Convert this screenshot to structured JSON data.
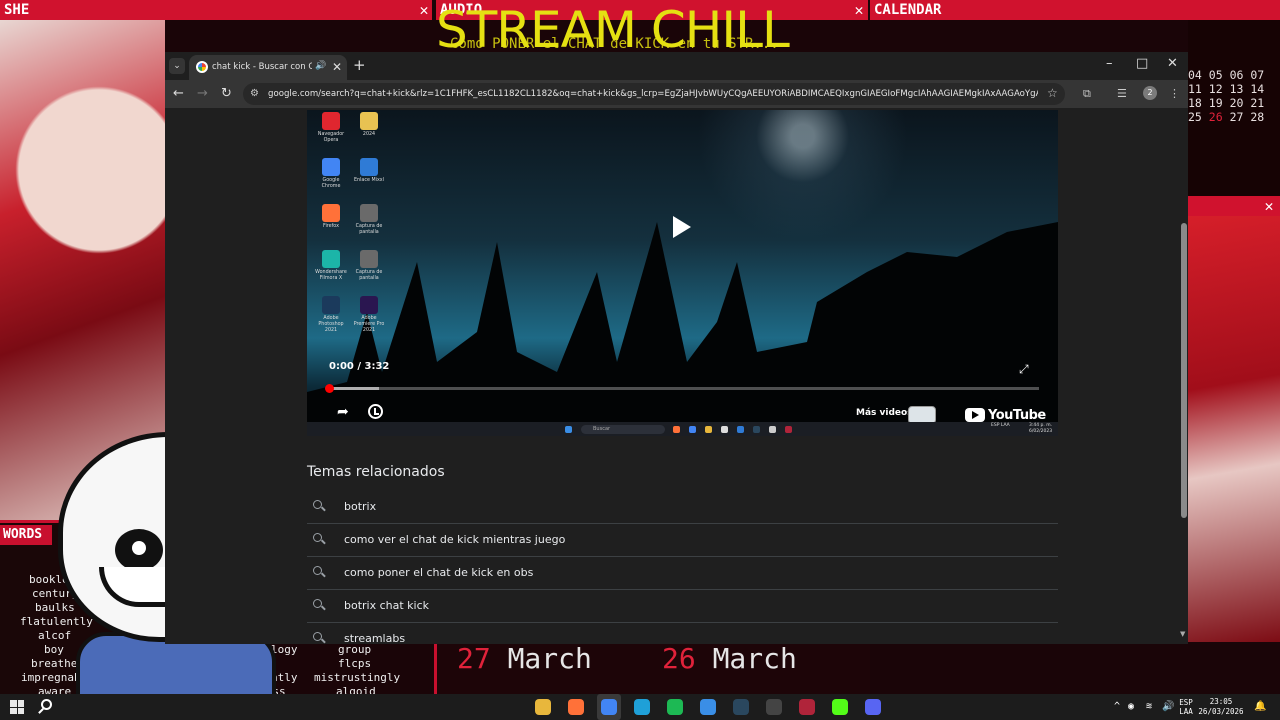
{
  "overlay": {
    "panels": {
      "she": "SHE",
      "audio": "AUDIO",
      "calendar": "CALENDAR",
      "words": "WORDS"
    },
    "stream_title": "STREAM CHILL",
    "audio_track": "Como PONER el CHAT de KICK en tu STR...",
    "calendar_rows": [
      [
        "04",
        "05",
        "06",
        "07"
      ],
      [
        "11",
        "12",
        "13",
        "14"
      ],
      [
        "18",
        "19",
        "20",
        "21"
      ],
      [
        "25",
        "26",
        "27",
        "28"
      ]
    ],
    "calendar_today": "26",
    "words": [
      "booklet",
      "century",
      "baulks",
      "flatulently",
      "alcof",
      "boy",
      "breathe",
      "impregnably",
      "aware",
      "anthropology",
      "brays",
      "inconstantly",
      "childless",
      "group",
      "flcps",
      "mistrustingly",
      "algoid"
    ],
    "dates": [
      {
        "num": "27",
        "month": "March"
      },
      {
        "num": "26",
        "month": "March"
      }
    ]
  },
  "browser": {
    "tab": {
      "title": "chat kick - Buscar con Google",
      "audio_icon": "speaker-icon"
    },
    "url": "google.com/search?q=chat+kick&rlz=1C1FHFK_esCL1182CL1182&oq=chat+kick&gs_lcrp=EgZjaHJvbWUyCQgAEEUYORiABDIMCAEQIxgnGIAEGIoFMgcIAhAAGIAEMgkIAxAAGAoYgAQyB",
    "profile_badge": "2"
  },
  "video": {
    "time": "0:00 / 3:32",
    "progress": 0.0,
    "more_videos": "Más videos",
    "youtube": "YouTube",
    "desktop_icons": [
      {
        "label": "Navegador Opera",
        "color": "#e0262f"
      },
      {
        "label": "2024",
        "color": "#e8c252"
      },
      {
        "label": "Google Chrome",
        "color": "#4285f4"
      },
      {
        "label": "Enlace Mixxl",
        "color": "#2f7bd6"
      },
      {
        "label": "Firefox",
        "color": "#ff7139"
      },
      {
        "label": "Captura de pantalla",
        "color": "#6a6a6a"
      },
      {
        "label": "Wondershare Filmora X",
        "color": "#1cb5a8"
      },
      {
        "label": "Captura de pantalla",
        "color": "#6a6a6a"
      },
      {
        "label": "Adobe Photoshop 2021",
        "color": "#1b3a5c"
      },
      {
        "label": "Adobe Premiere Pro 2021",
        "color": "#2a1650"
      }
    ],
    "inner_taskbar": {
      "search": "Buscar",
      "lang": "ESP LAA",
      "clock": "3:44 p. m. 6/02/2023"
    }
  },
  "related": {
    "title": "Temas relacionados",
    "items": [
      "botrix",
      "como ver el chat de kick mientras juego",
      "como poner el chat de kick en obs",
      "botrix chat kick",
      "streamlabs"
    ]
  },
  "taskbar": {
    "apps": [
      {
        "name": "file-explorer-icon",
        "color": "#e8b73c"
      },
      {
        "name": "firefox-icon",
        "color": "#ff7139"
      },
      {
        "name": "chrome-icon",
        "color": "#4285f4"
      },
      {
        "name": "edge-icon",
        "color": "#1fa0d8"
      },
      {
        "name": "spotify-icon",
        "color": "#1db954"
      },
      {
        "name": "app-icon",
        "color": "#3a8ee6"
      },
      {
        "name": "steam-icon",
        "color": "#2a475e"
      },
      {
        "name": "obs-icon",
        "color": "#444444"
      },
      {
        "name": "app-icon",
        "color": "#b0243a"
      },
      {
        "name": "kick-icon",
        "color": "#53fc18"
      },
      {
        "name": "discord-icon",
        "color": "#5865f2"
      }
    ],
    "lang": "ESP\nLAA",
    "time": "23:05",
    "date": "26/03/2026"
  }
}
